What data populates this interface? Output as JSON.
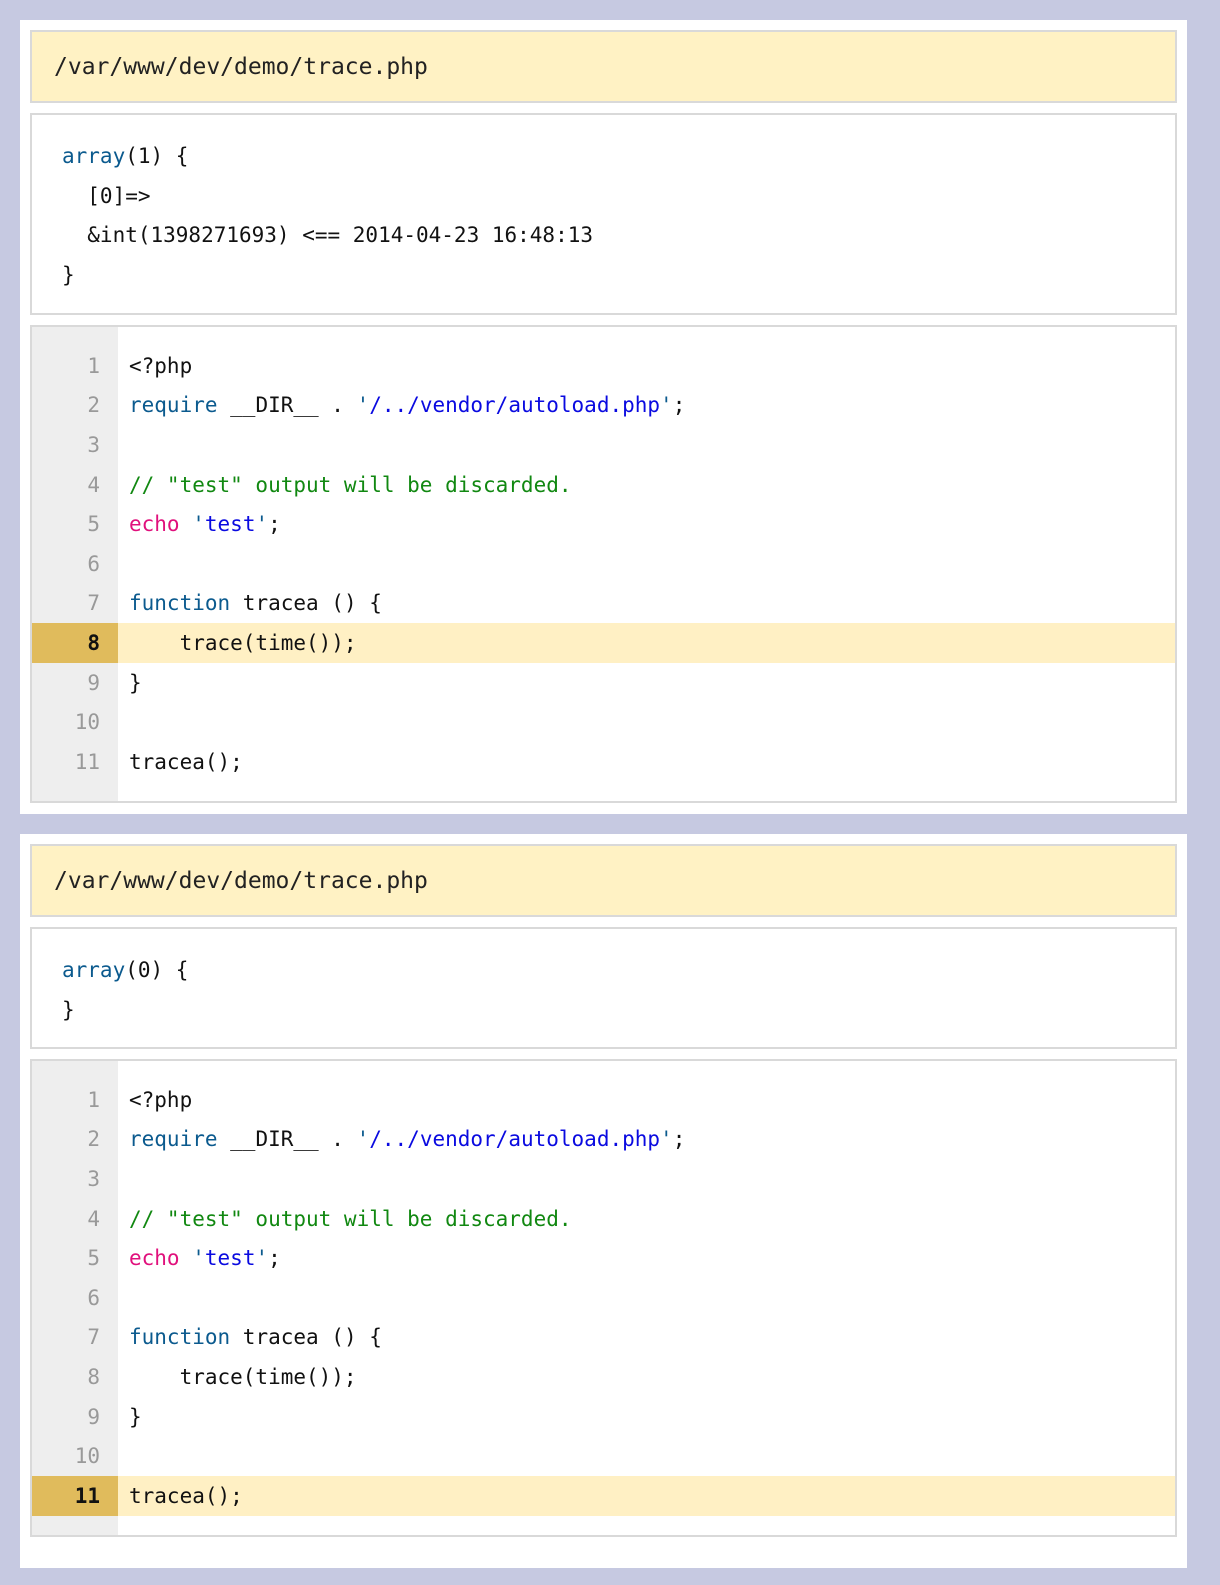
{
  "panels": [
    {
      "file_path": "/var/www/dev/demo/trace.php",
      "dump": {
        "open_keyword": "array",
        "open_rest": "(1) {",
        "line2": "  [0]=>",
        "line3": "  &int(1398271693) <== 2014-04-23 16:48:13",
        "close": "}"
      },
      "highlighted_line": 8
    },
    {
      "file_path": "/var/www/dev/demo/trace.php",
      "dump": {
        "open_keyword": "array",
        "open_rest": "(0) {",
        "close": "}"
      },
      "highlighted_line": 11
    }
  ],
  "source": {
    "line_numbers": [
      "1",
      "2",
      "3",
      "4",
      "5",
      "6",
      "7",
      "8",
      "9",
      "10",
      "11"
    ],
    "l1": "<?php",
    "l2_kw": "require",
    "l2_mid": " __DIR__ . ",
    "l2_q1": "'",
    "l2_str": "/../vendor/autoload.php",
    "l2_q2": "'",
    "l2_end": ";",
    "l4_comment": "// \"test\" output will be discarded.",
    "l5_kw": "echo",
    "l5_q1": "'",
    "l5_str": "test",
    "l5_q2": "'",
    "l5_end": ";",
    "l7_kw": "function",
    "l7_rest": " tracea () {",
    "l8": "    trace(time());",
    "l9": "}",
    "l11": "tracea();"
  }
}
